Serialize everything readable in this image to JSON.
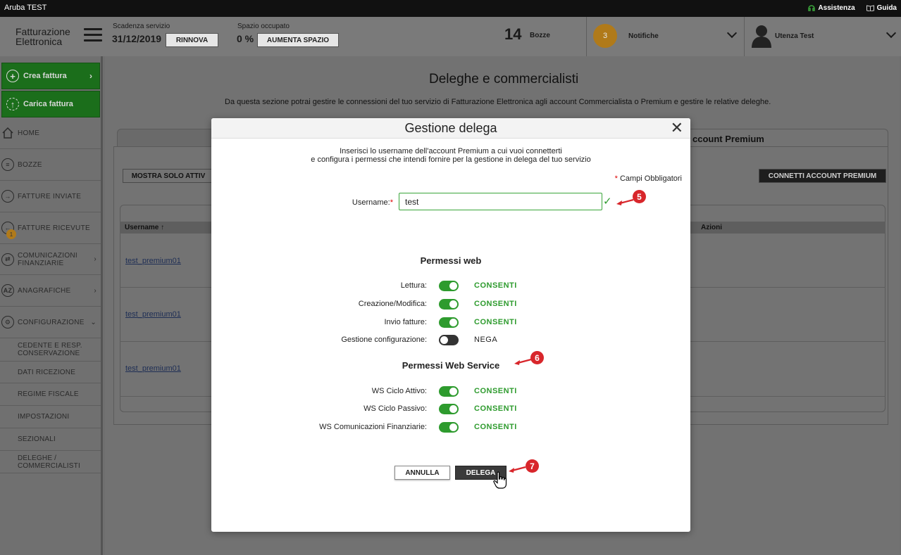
{
  "topbar": {
    "app_title": "Aruba TEST",
    "assistenza": "Assistenza",
    "guida": "Guida"
  },
  "header": {
    "logo_line1": "Fatturazione",
    "logo_line2": "Elettronica",
    "scadenza_label": "Scadenza servizio",
    "scadenza_value": "31/12/2019",
    "rinnova_label": "RINNOVA",
    "spazio_label": "Spazio occupato",
    "spazio_value": "0 %",
    "aumenta_label": "AUMENTA SPAZIO",
    "bozze_count": "14",
    "bozze_label": "Bozze",
    "notifiche_count": "3",
    "notifiche_label": "Notifiche",
    "user_label": "Utenza Test"
  },
  "sidebar": {
    "crea": "Crea fattura",
    "carica": "Carica fattura",
    "items": [
      {
        "label": "HOME",
        "icon": "home-icon"
      },
      {
        "label": "BOZZE",
        "icon": "drafts-icon"
      },
      {
        "label": "FATTURE INVIATE",
        "icon": "arrow-right-icon"
      },
      {
        "label": "FATTURE RICEVUTE",
        "icon": "arrow-left-icon",
        "badge": "1"
      },
      {
        "label": "COMUNICAZIONI FINANZIARIE",
        "icon": "exchange-icon"
      },
      {
        "label": "ANAGRAFICHE",
        "icon": "az-icon"
      },
      {
        "label": "CONFIGURAZIONE",
        "icon": "gear-icon"
      }
    ],
    "subitems": [
      "CEDENTE E RESP. CONSERVAZIONE",
      "DATI RICEZIONE",
      "REGIME FISCALE",
      "IMPOSTAZIONI",
      "SEZIONALI",
      "DELEGHE / COMMERCIALISTI"
    ]
  },
  "page": {
    "title": "Deleghe e commercialisti",
    "description": "Da questa sezione potrai gestire le connessioni del tuo servizio di Fatturazione Elettronica agli account Commercialista o Premium e gestire le relative deleghe.",
    "tab_right": "ccount Premium",
    "mostra_btn": "MOSTRA SOLO ATTIV",
    "connetti_btn": "CONNETTI ACCOUNT PREMIUM",
    "col_username": "Username ↑",
    "col_azioni": "Azioni",
    "rows": [
      "test_premium01",
      "test_premium01",
      "test_premium01"
    ]
  },
  "modal": {
    "title": "Gestione delega",
    "intro_line1": "Inserisci lo username dell'account Premium a cui vuoi connetterti",
    "intro_line2": "e configura i permessi che intendi fornire per la gestione in delega del tuo servizio",
    "required_note": "Campi Obbligatori",
    "username_label": "Username:",
    "username_value": "test",
    "web_title": "Permessi web",
    "web_perms": [
      {
        "label": "Lettura:",
        "value": "CONSENTI",
        "on": true
      },
      {
        "label": "Creazione/Modifica:",
        "value": "CONSENTI",
        "on": true
      },
      {
        "label": "Invio fatture:",
        "value": "CONSENTI",
        "on": true
      },
      {
        "label": "Gestione configurazione:",
        "value": "NEGA",
        "on": false
      }
    ],
    "ws_title": "Permessi Web Service",
    "ws_perms": [
      {
        "label": "WS Ciclo Attivo:",
        "value": "CONSENTI",
        "on": true
      },
      {
        "label": "WS Ciclo Passivo:",
        "value": "CONSENTI",
        "on": true
      },
      {
        "label": "WS Comunicazioni Finanziarie:",
        "value": "CONSENTI",
        "on": true
      }
    ],
    "annulla": "ANNULLA",
    "delega": "DELEGA"
  },
  "markers": [
    "5",
    "6",
    "7"
  ],
  "colors": {
    "accent_green": "#2e9b2e",
    "marker_red": "#d8262b",
    "badge_orange": "#f0a020"
  }
}
